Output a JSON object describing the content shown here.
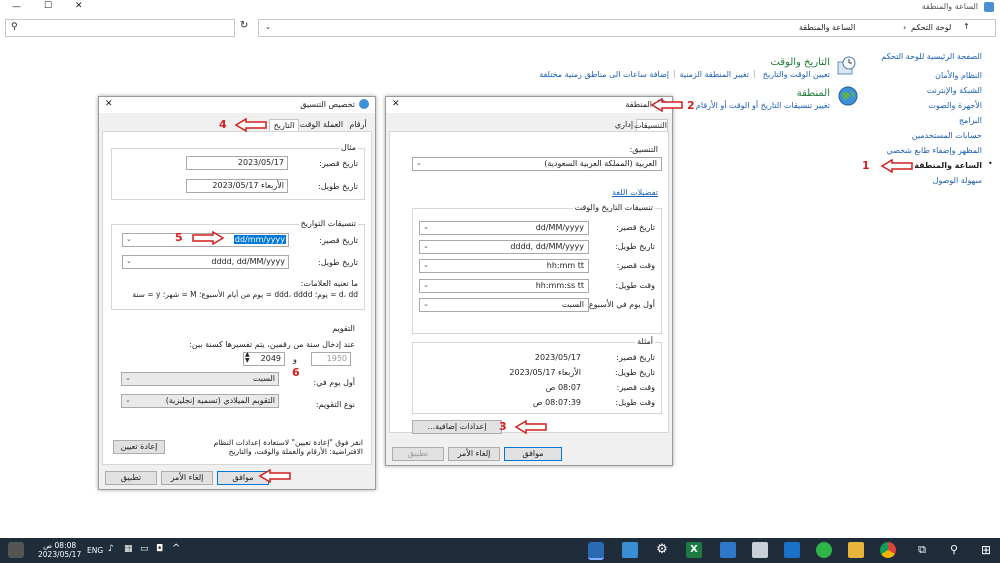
{
  "window": {
    "title": "الساعة والمنطقة"
  },
  "address": {
    "crumb_root": "لوحة التحكم",
    "crumb_current": "الساعة والمنطقة"
  },
  "sidebar": {
    "home": "الصفحة الرئيسية للوحة التحكم",
    "items": [
      "النظام والأمان",
      "الشبكة والإنترنت",
      "الأجهزة والصوت",
      "البرامج",
      "حسابات المستخدمين",
      "المظهر وإضفاء طابع شخصي",
      "الساعة والمنطقة",
      "سهولة الوصول"
    ]
  },
  "sections": {
    "datetime": {
      "heading": "التاريخ والوقت",
      "links": [
        "تعيين الوقت والتاريخ",
        "تغيير المنطقة الزمنية",
        "إضافة ساعات الى مناطق زمنية مختلفة"
      ]
    },
    "region": {
      "heading": "المنطقة",
      "link": "تغيير تنسيقات التاريخ أو الوقت أو الأرقام"
    }
  },
  "region_dialog": {
    "title": "المنطقة",
    "tabs": [
      "التنسيقات",
      "إداري"
    ],
    "format_label": "التنسيق:",
    "format_value": "العربية (المملكة العربية السعودية)",
    "lang_prefs": "تفضيلات اللغة",
    "group_title": "تنسيقات التاريخ والوقت",
    "rows": [
      {
        "label": "تاريخ قصير:",
        "value": "dd/MM/yyyy"
      },
      {
        "label": "تاريخ طويل:",
        "value": "dddd, dd/MM/yyyy"
      },
      {
        "label": "وقت قصير:",
        "value": "hh:mm tt"
      },
      {
        "label": "وقت طويل:",
        "value": "hh:mm:ss tt"
      },
      {
        "label": "أول يوم في الأسبوع:",
        "value": "السبت"
      }
    ],
    "examples_title": "أمثلة",
    "examples": [
      {
        "label": "تاريخ قصير:",
        "value": "2023/05/17"
      },
      {
        "label": "تاريخ طويل:",
        "value": "الأربعاء 2023/05/17"
      },
      {
        "label": "وقت قصير:",
        "value": "08:07 ص"
      },
      {
        "label": "وقت طويل:",
        "value": "08:07:39 ص"
      }
    ],
    "additional": "إعدادات إضافية...",
    "ok": "موافق",
    "cancel": "إلغاء الأمر",
    "apply": "تطبيق"
  },
  "custom_dialog": {
    "title": "تخصيص التنسيق",
    "tabs": [
      "أرقام",
      "العملة",
      "الوقت",
      "التاريخ"
    ],
    "example_title": "مثال",
    "short_label": "تاريخ قصير:",
    "short_value": "2023/05/17",
    "long_label": "تاريخ طويل:",
    "long_value": "الأربعاء 2023/05/17",
    "formats_title": "تنسيقات التواريخ",
    "short_fmt_label": "تاريخ قصير:",
    "short_fmt_value": "dd/mm/yyyy",
    "long_fmt_label": "تاريخ طويل:",
    "long_fmt_value": "dddd, dd/MM/yyyy",
    "notation_title": "ما تعنيه العلامات:",
    "notation_text": "d، dd = يوم؛ ddd، dddd = يوم من أيام الأسبوع؛ M = شهر؛ y = سنة",
    "calendar_title": "التقويم",
    "two_digit_text": "عند إدخال سنة من رقمين، يتم تفسيرها كسنة بين:",
    "year_from": "1950",
    "and_word": "و",
    "year_to": "2049",
    "first_day_label": "أول يوم في:",
    "first_day_value": "السبت",
    "cal_type_label": "نوع التقويم:",
    "cal_type_value": "التقويم الميلادي (تسميه إنجليزية)",
    "reset_text": "انقر فوق \"إعادة تعيين\" لاستعادة إعدادات النظام الافتراضية: الأرقام والعملة والوقت، والتاريخ",
    "reset_button": "إعادة تعيين",
    "ok": "موافق",
    "cancel": "إلغاء الأمر",
    "apply": "تطبيق"
  },
  "annotations": [
    "1",
    "2",
    "3",
    "4",
    "5",
    "6"
  ],
  "taskbar": {
    "time": "08:08 ص",
    "date": "2023/05/17",
    "lang": "ENG"
  },
  "colors": {
    "arrow": "#d21f1f",
    "link": "#1a5fb4",
    "heading": "#1e7b34",
    "taskbar": "#1f2c3a"
  }
}
